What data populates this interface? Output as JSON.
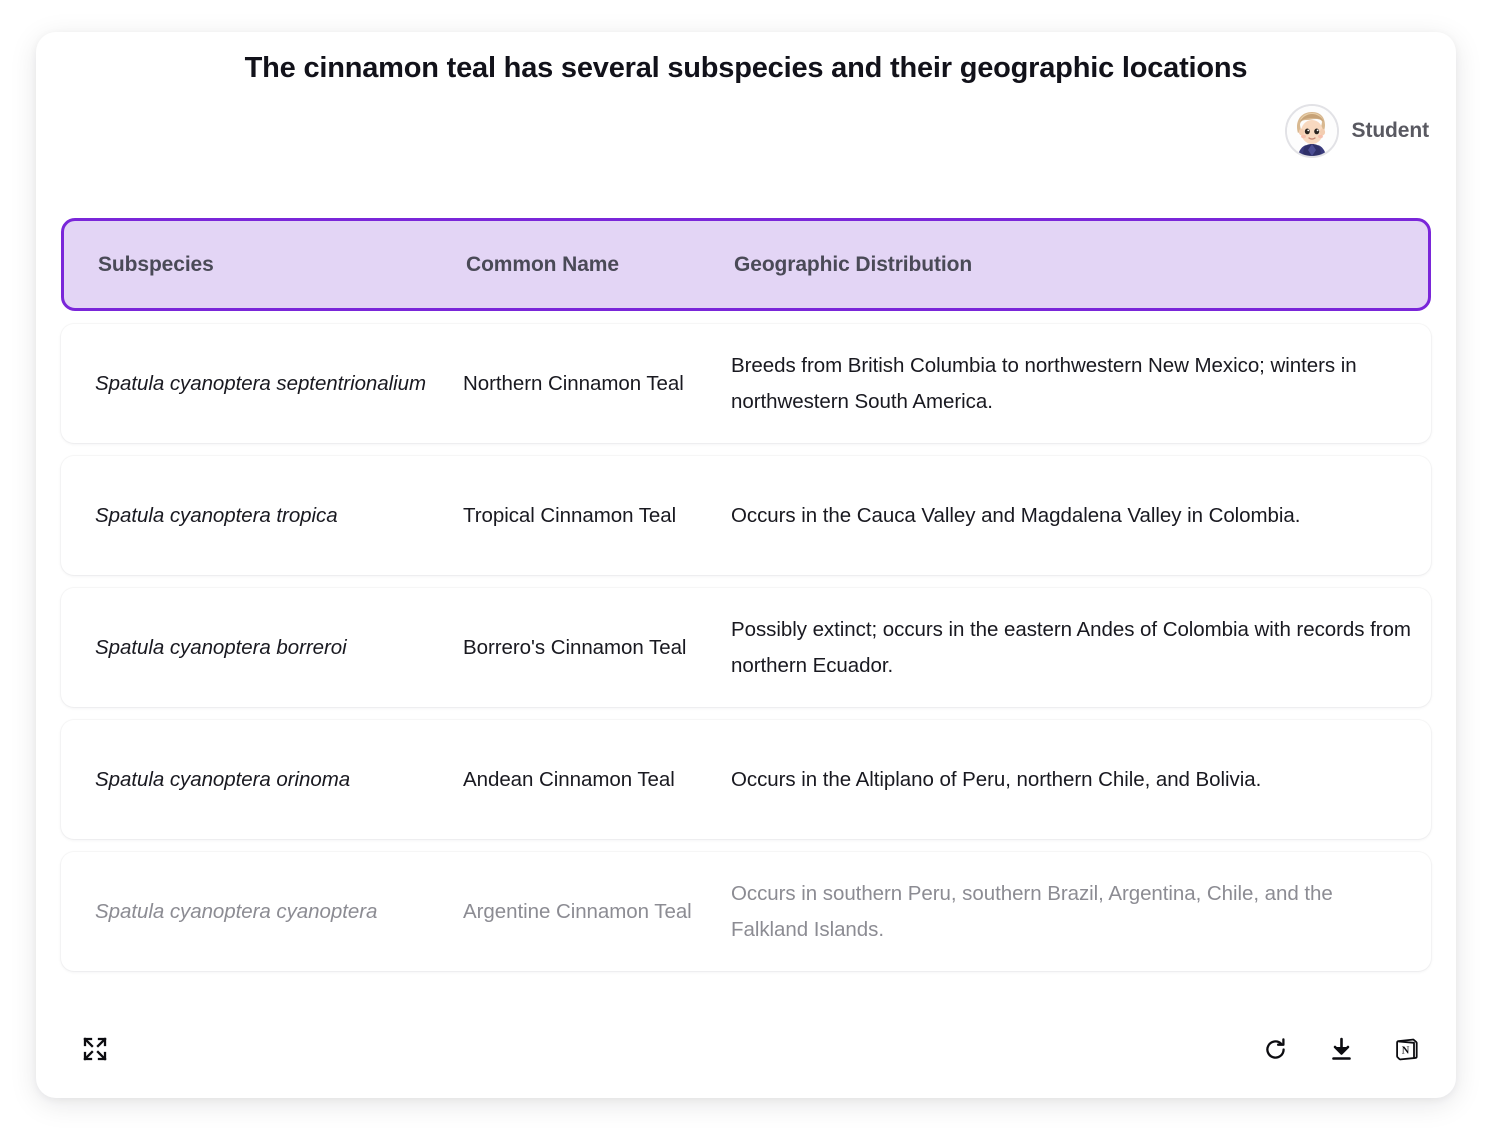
{
  "card": {
    "title": "The cinnamon teal has several subspecies and their geographic locations",
    "user": {
      "name": "Student",
      "avatar_icon": "student-avatar-icon"
    }
  },
  "table": {
    "headers": {
      "subspecies": "Subspecies",
      "common_name": "Common Name",
      "geographic_distribution": "Geographic Distribution"
    },
    "accent_color": "#7a26d9",
    "header_fill": "#e3d5f5",
    "muted_text_color": "#8c8c93",
    "rows": [
      {
        "subspecies": "Spatula cyanoptera septentrionalium",
        "common_name": "Northern Cinnamon Teal",
        "geographic_distribution": "Breeds from British Columbia to northwestern New Mexico; winters in northwestern South America.",
        "muted": false
      },
      {
        "subspecies": "Spatula cyanoptera tropica",
        "common_name": "Tropical Cinnamon Teal",
        "geographic_distribution": "Occurs in the Cauca Valley and Magdalena Valley in Colombia.",
        "muted": false
      },
      {
        "subspecies": "Spatula cyanoptera borreroi",
        "common_name": "Borrero's Cinnamon Teal",
        "geographic_distribution": "Possibly extinct; occurs in the eastern Andes of Colombia with records from northern Ecuador.",
        "muted": false
      },
      {
        "subspecies": "Spatula cyanoptera orinoma",
        "common_name": "Andean Cinnamon Teal",
        "geographic_distribution": "Occurs in the Altiplano of Peru, northern Chile, and Bolivia.",
        "muted": false
      },
      {
        "subspecies": "Spatula cyanoptera cyanoptera",
        "common_name": "Argentine Cinnamon Teal",
        "geographic_distribution": "Occurs in southern Peru, southern Brazil, Argentina, Chile, and the Falkland Islands.",
        "muted": true
      }
    ]
  },
  "toolbar": {
    "expand_icon": "expand-fullscreen-icon",
    "refresh_icon": "refresh-regenerate-icon",
    "download_icon": "download-icon",
    "notion_icon": "notion-logo-icon"
  }
}
